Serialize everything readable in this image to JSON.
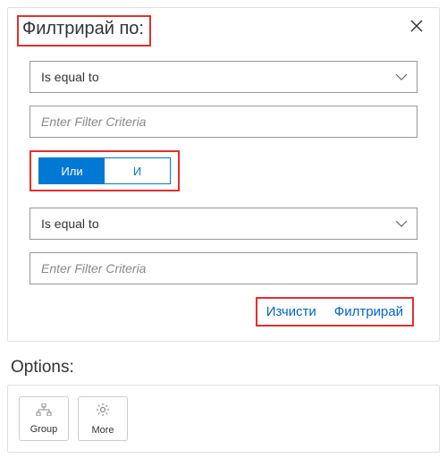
{
  "filter": {
    "title": "Филтрирай по:",
    "criteria": [
      {
        "operator": "Is equal to",
        "placeholder": "Enter Filter Criteria",
        "value": ""
      },
      {
        "operator": "Is equal to",
        "placeholder": "Enter Filter Criteria",
        "value": ""
      }
    ],
    "logic": {
      "or_label": "Или",
      "and_label": "И",
      "selected": "or"
    },
    "actions": {
      "clear": "Изчисти",
      "apply": "Филтрирай"
    }
  },
  "options": {
    "title": "Options:",
    "buttons": {
      "group": "Group",
      "more": "More"
    }
  }
}
